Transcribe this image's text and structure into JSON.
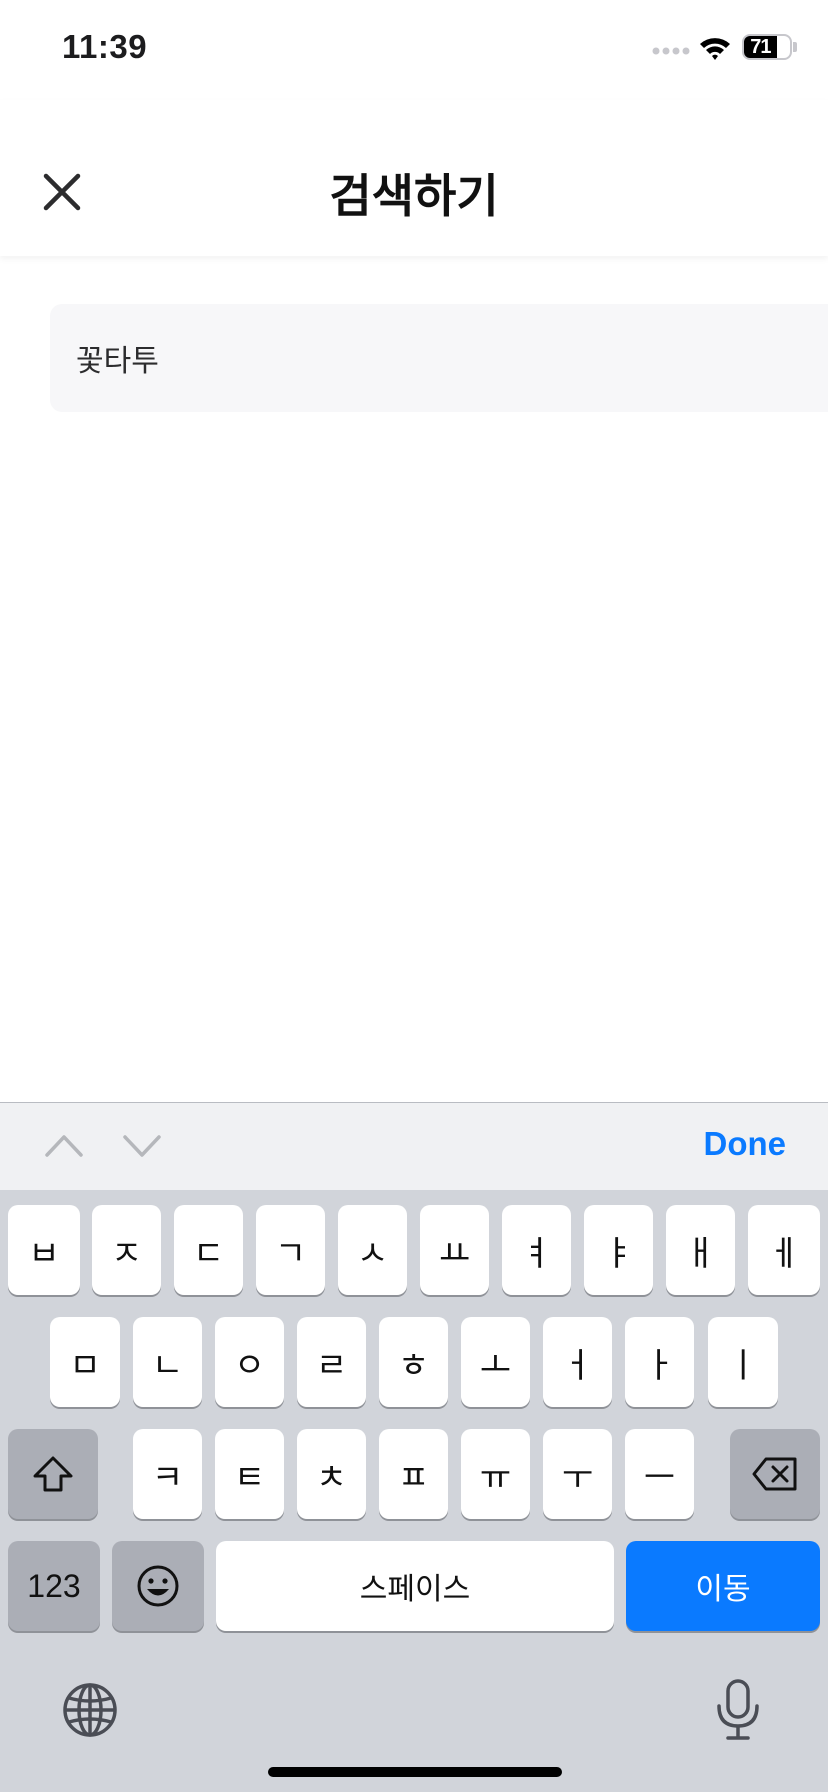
{
  "status_bar": {
    "time": "11:39",
    "battery": "71",
    "battery_level": 0.71
  },
  "header": {
    "title": "검색하기",
    "close_icon": "close-icon"
  },
  "search": {
    "value": "꽃타투",
    "placeholder": ""
  },
  "accessory": {
    "done_label": "Done",
    "prev_icon": "chevron-up-icon",
    "next_icon": "chevron-down-icon"
  },
  "keyboard": {
    "row1": [
      "ㅂ",
      "ㅈ",
      "ㄷ",
      "ㄱ",
      "ㅅ",
      "ㅛ",
      "ㅕ",
      "ㅑ",
      "ㅐ",
      "ㅔ"
    ],
    "row2": [
      "ㅁ",
      "ㄴ",
      "ㅇ",
      "ㄹ",
      "ㅎ",
      "ㅗ",
      "ㅓ",
      "ㅏ",
      "ㅣ"
    ],
    "row3": [
      "ㅋ",
      "ㅌ",
      "ㅊ",
      "ㅍ",
      "ㅠ",
      "ㅜ",
      "ㅡ"
    ],
    "numbers_label": "123",
    "space_label": "스페이스",
    "return_label": "이동",
    "shift_icon": "shift-icon",
    "delete_icon": "backspace-icon",
    "emoji_icon": "emoji-icon",
    "globe_icon": "globe-icon",
    "mic_icon": "microphone-icon"
  },
  "colors": {
    "accent": "#0a7aff",
    "keyboard_bg": "#d1d4da",
    "key_bg": "#ffffff",
    "dark_key_bg": "#abaeb6"
  }
}
